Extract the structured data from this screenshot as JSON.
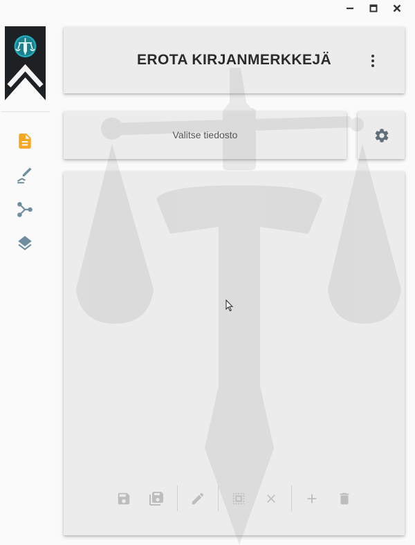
{
  "window_controls": {
    "minimize": "minimize-icon",
    "maximize": "maximize-icon",
    "close": "close-icon"
  },
  "sidebar": {
    "items": [
      {
        "icon": "document-icon",
        "active": true
      },
      {
        "icon": "edit-signature-icon",
        "active": false
      },
      {
        "icon": "merge-icon",
        "active": false
      },
      {
        "icon": "layers-icon",
        "active": false
      }
    ]
  },
  "header": {
    "title": "EROTA KIRJANMERKKEJÄ",
    "menu_icon": "more-vert-icon"
  },
  "file_select": {
    "label": "Valitse tiedosto"
  },
  "settings": {
    "icon": "gear-icon"
  },
  "toolbar": {
    "buttons": [
      "save-icon",
      "save-all-icon",
      "edit-icon",
      "select-all-icon",
      "close-icon",
      "add-icon",
      "delete-icon"
    ]
  },
  "colors": {
    "accent": "#f5a623",
    "icon": "#6f8d9f",
    "toolbar_icon": "#bdbdbd",
    "title": "#2b2b2b"
  }
}
